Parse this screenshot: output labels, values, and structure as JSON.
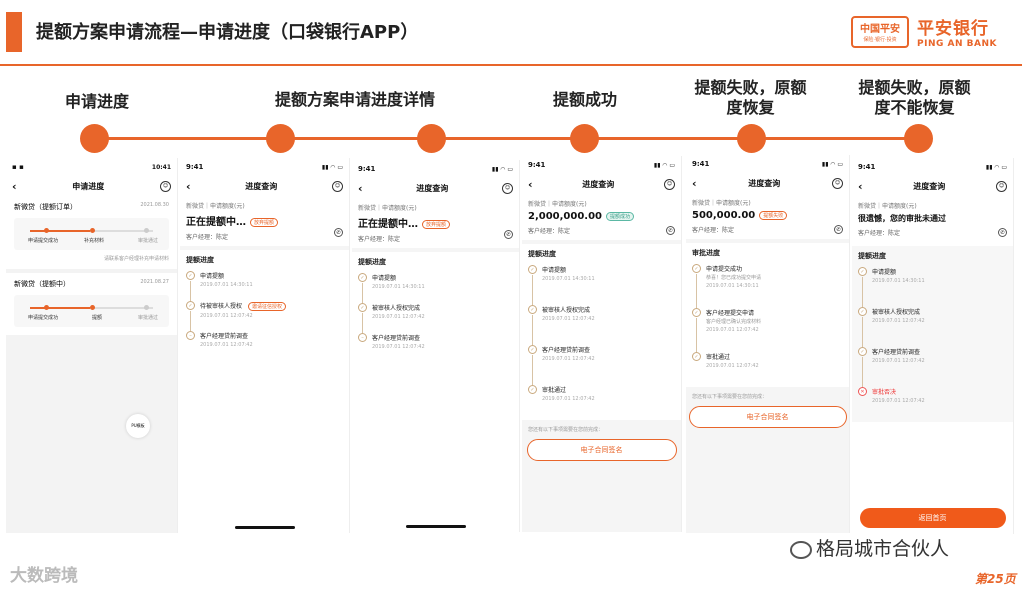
{
  "header": {
    "title": "提额方案申请流程—申请进度（口袋银行APP）",
    "logo_box_line1": "中国平安",
    "logo_box_line2": "保险·银行·投资",
    "logo_name": "平安银行",
    "logo_en": "PING AN BANK"
  },
  "stages": [
    {
      "label": "申请进度"
    },
    {
      "label": "提额方案申请进度详情"
    },
    {
      "label": "提额成功"
    },
    {
      "label": "提额失败，原额度恢复"
    },
    {
      "label": "提额失败，原额度不能恢复"
    }
  ],
  "phone1": {
    "time": "10:41",
    "nav_title": "申请进度",
    "loans": [
      {
        "name": "新微贷（提额订单）",
        "date": "2021.08.30",
        "steps": [
          "申请提交成功",
          "补充材料",
          "审批通过"
        ],
        "hint": "请联系客户经理补充申请材料"
      },
      {
        "name": "新微贷（提额中）",
        "date": "2021.08.27",
        "steps": [
          "申请提交成功",
          "提额",
          "审批通过"
        ]
      }
    ],
    "pu_label": "PU模板"
  },
  "phones": [
    {
      "time": "9:41",
      "nav_title": "进度查询",
      "product": "新微贷｜申请额度(元)",
      "amount": "正在提额中…",
      "badge": "放弃提额",
      "manager": "客户经理：陈定",
      "progress_title": "提额进度",
      "steps": [
        {
          "label": "申请提额",
          "date": "2019.07.01 14:30:11"
        },
        {
          "label": "待被审核人授权",
          "date": "2019.07.01 12:07:42",
          "action": "邀请征信授权"
        },
        {
          "label": "客户经理贷前调查",
          "date": "2019.07.01 12:07:42"
        }
      ]
    },
    {
      "time": "9:41",
      "nav_title": "进度查询",
      "product": "新微贷｜申请额度(元)",
      "amount": "正在提额中…",
      "badge": "放弃提额",
      "manager": "客户经理：陈定",
      "progress_title": "提额进度",
      "steps": [
        {
          "label": "申请提额",
          "date": "2019.07.01 14:30:11"
        },
        {
          "label": "被审核人授权完成",
          "date": "2019.07.01 12:07:42"
        },
        {
          "label": "客户经理贷前调查",
          "date": "2019.07.01 12:07:42"
        }
      ]
    },
    {
      "time": "9:41",
      "nav_title": "进度查询",
      "product": "新微贷｜申请额度(元)",
      "amount": "2,000,000.00",
      "badge": "提额成功",
      "manager": "客户经理：陈定",
      "progress_title": "提额进度",
      "steps": [
        {
          "label": "申请提额",
          "date": "2019.07.01 14:30:11"
        },
        {
          "label": "被审核人授权完成",
          "date": "2019.07.01 12:07:42"
        },
        {
          "label": "客户经理贷前调查",
          "date": "2019.07.01 12:07:42"
        },
        {
          "label": "审批通过",
          "date": "2019.07.01 12:07:42"
        }
      ],
      "note": "您还有以下事项需要在您前完成：",
      "button": "电子合同签名"
    },
    {
      "time": "9:41",
      "nav_title": "进度查询",
      "product": "新微贷｜申请额度(元)",
      "amount": "500,000.00",
      "badge": "提额失败",
      "manager": "客户经理：陈定",
      "progress_title": "审批进度",
      "steps": [
        {
          "label": "申请提交成功",
          "sub": "恭喜！您已成功提交申请",
          "date": "2019.07.01 14:30:11"
        },
        {
          "label": "客户经理提交申请",
          "sub": "客户经理已确认完成材料",
          "date": "2019.07.01 12:07:42"
        },
        {
          "label": "审批通过",
          "date": "2019.07.01 12:07:42"
        }
      ],
      "note": "您还有以下事项需要在您前完成：",
      "button": "电子合同签名"
    },
    {
      "time": "9:41",
      "nav_title": "进度查询",
      "product": "新微贷｜申请额度(元)",
      "amount": "很遗憾，您的审批未通过",
      "manager": "客户经理：陈定",
      "progress_title": "提额进度",
      "steps": [
        {
          "label": "申请提额",
          "date": "2019.07.01 14:30:11"
        },
        {
          "label": "被审核人授权完成",
          "date": "2019.07.01 12:07:42"
        },
        {
          "label": "客户经理贷前调查",
          "date": "2019.07.01 12:07:42"
        },
        {
          "label": "审批否决",
          "date": "2019.07.01 12:07:42",
          "rejected": true
        }
      ],
      "button": "返回首页"
    }
  ],
  "footer": {
    "watermark_left": "大数跨境",
    "watermark_right": "格局城市合伙人",
    "page": "第25页"
  }
}
